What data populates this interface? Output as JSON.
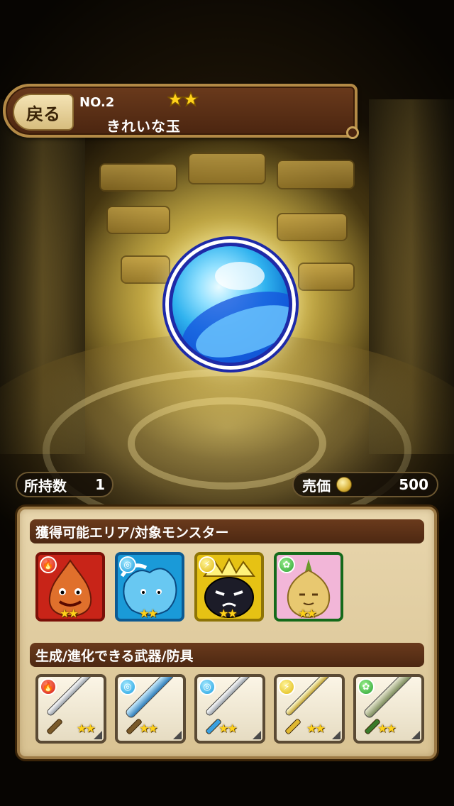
{
  "header": {
    "back_label": "戻る",
    "item_no": "NO.2",
    "rarity": "★★",
    "item_name": "きれいな玉"
  },
  "owned": {
    "label": "所持数",
    "value": "1"
  },
  "price": {
    "label": "売価",
    "value": "500"
  },
  "sections": {
    "areas_title": "獲得可能エリア/対象モンスター",
    "weapons_title": "生成/進化できる武器/防具"
  },
  "monsters": [
    {
      "attribute": "fire",
      "rarity": "★★",
      "icon": "fire-monster-icon"
    },
    {
      "attribute": "water",
      "rarity": "★★",
      "icon": "water-monster-icon"
    },
    {
      "attribute": "thunder",
      "rarity": "★★",
      "icon": "thunder-monster-icon"
    },
    {
      "attribute": "wood",
      "rarity": "★★",
      "icon": "wood-monster-icon"
    }
  ],
  "weapons": [
    {
      "attribute": "fire",
      "rarity": "★★",
      "icon": "fire-sword-icon"
    },
    {
      "attribute": "water",
      "rarity": "★★",
      "icon": "water-blade-icon"
    },
    {
      "attribute": "water",
      "rarity": "★★",
      "icon": "water-sword-icon"
    },
    {
      "attribute": "thunder",
      "rarity": "★★",
      "icon": "thunder-blade-icon"
    },
    {
      "attribute": "wood",
      "rarity": "★★",
      "icon": "wood-blade-icon"
    }
  ],
  "colors": {
    "panel": "#e8d6ad",
    "bar": "#5a2f16",
    "fire": "#c82418",
    "water": "#1a9ad8",
    "thunder": "#e6c214",
    "wood": "#34b43a"
  }
}
